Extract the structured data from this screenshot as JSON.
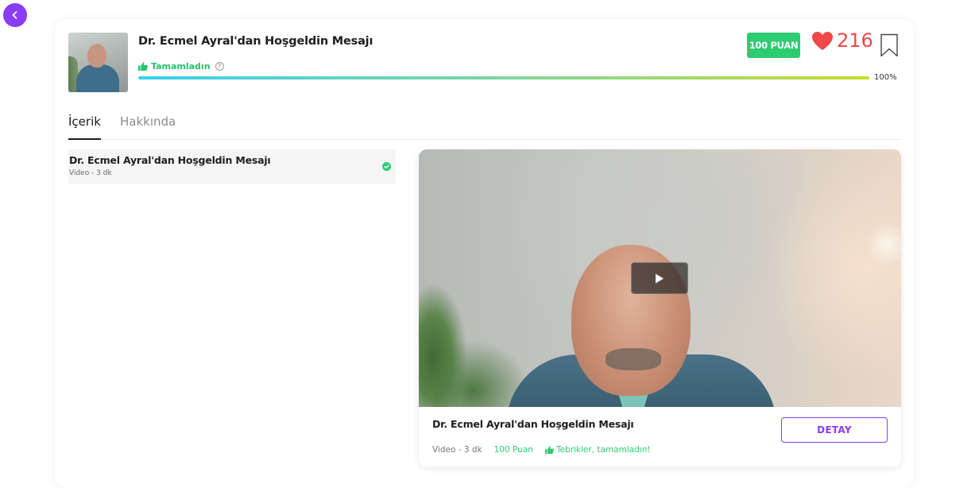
{
  "header": {
    "title": "Dr. Ecmel Ayral'dan Hoşgeldin Mesajı",
    "status_label": "Tamamladın",
    "progress_value": 100,
    "progress_label": "100%",
    "points_badge": "100 PUAN",
    "likes_count": "216"
  },
  "tabs": [
    {
      "label": "İçerik",
      "active": true
    },
    {
      "label": "Hakkında",
      "active": false
    }
  ],
  "content_list": [
    {
      "title": "Dr. Ecmel Ayral'dan Hoşgeldin Mesajı",
      "meta": "Video - 3 dk",
      "completed": true
    }
  ],
  "video_card": {
    "title": "Dr. Ecmel Ayral'dan Hoşgeldin Mesajı",
    "duration": "Video - 3 dk",
    "points": "100 Puan",
    "congrats": "Tebrikler, tamamladın!",
    "detail_button": "DETAY"
  },
  "colors": {
    "accent": "#8b3cf7",
    "success": "#2ecc71",
    "heart": "#f04848",
    "progress_start": "#35d2ef",
    "progress_end": "#c6dc2a"
  },
  "icons": {
    "back": "chevron-left-icon",
    "status": "thumbs-up-icon",
    "info": "info-icon",
    "likes": "heart-icon",
    "bookmark": "bookmark-icon",
    "completed": "check-circle-icon",
    "play": "play-icon"
  }
}
